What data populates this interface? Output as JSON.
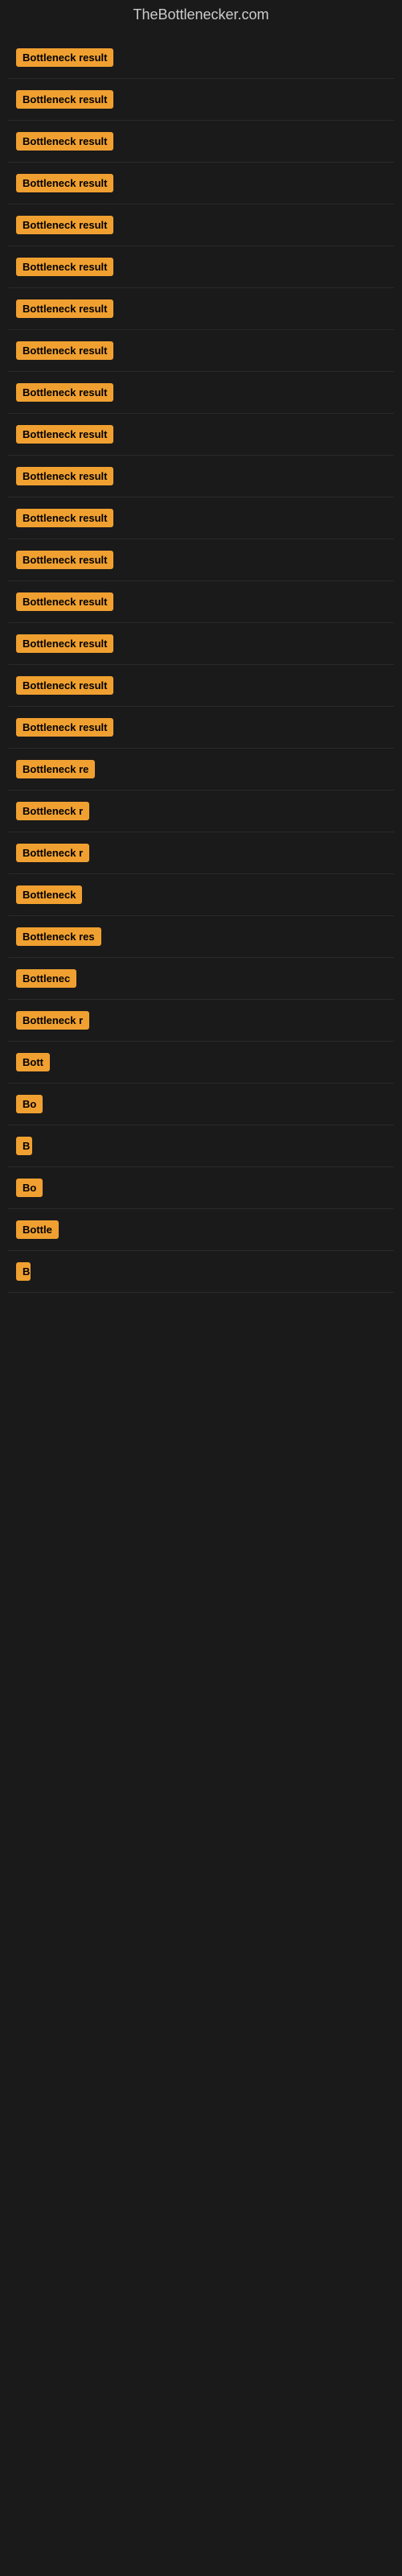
{
  "site": {
    "title": "TheBottlenecker.com"
  },
  "items": [
    {
      "label": "Bottleneck result",
      "width": 155
    },
    {
      "label": "Bottleneck result",
      "width": 155
    },
    {
      "label": "Bottleneck result",
      "width": 155
    },
    {
      "label": "Bottleneck result",
      "width": 155
    },
    {
      "label": "Bottleneck result",
      "width": 155
    },
    {
      "label": "Bottleneck result",
      "width": 155
    },
    {
      "label": "Bottleneck result",
      "width": 155
    },
    {
      "label": "Bottleneck result",
      "width": 155
    },
    {
      "label": "Bottleneck result",
      "width": 155
    },
    {
      "label": "Bottleneck result",
      "width": 155
    },
    {
      "label": "Bottleneck result",
      "width": 155
    },
    {
      "label": "Bottleneck result",
      "width": 155
    },
    {
      "label": "Bottleneck result",
      "width": 155
    },
    {
      "label": "Bottleneck result",
      "width": 155
    },
    {
      "label": "Bottleneck result",
      "width": 155
    },
    {
      "label": "Bottleneck result",
      "width": 145
    },
    {
      "label": "Bottleneck result",
      "width": 145
    },
    {
      "label": "Bottleneck re",
      "width": 120
    },
    {
      "label": "Bottleneck r",
      "width": 110
    },
    {
      "label": "Bottleneck r",
      "width": 115
    },
    {
      "label": "Bottleneck",
      "width": 100
    },
    {
      "label": "Bottleneck res",
      "width": 125
    },
    {
      "label": "Bottlenec",
      "width": 95
    },
    {
      "label": "Bottleneck r",
      "width": 112
    },
    {
      "label": "Bott",
      "width": 60
    },
    {
      "label": "Bo",
      "width": 40
    },
    {
      "label": "B",
      "width": 20
    },
    {
      "label": "Bo",
      "width": 38
    },
    {
      "label": "Bottle",
      "width": 65
    },
    {
      "label": "B",
      "width": 18
    }
  ]
}
